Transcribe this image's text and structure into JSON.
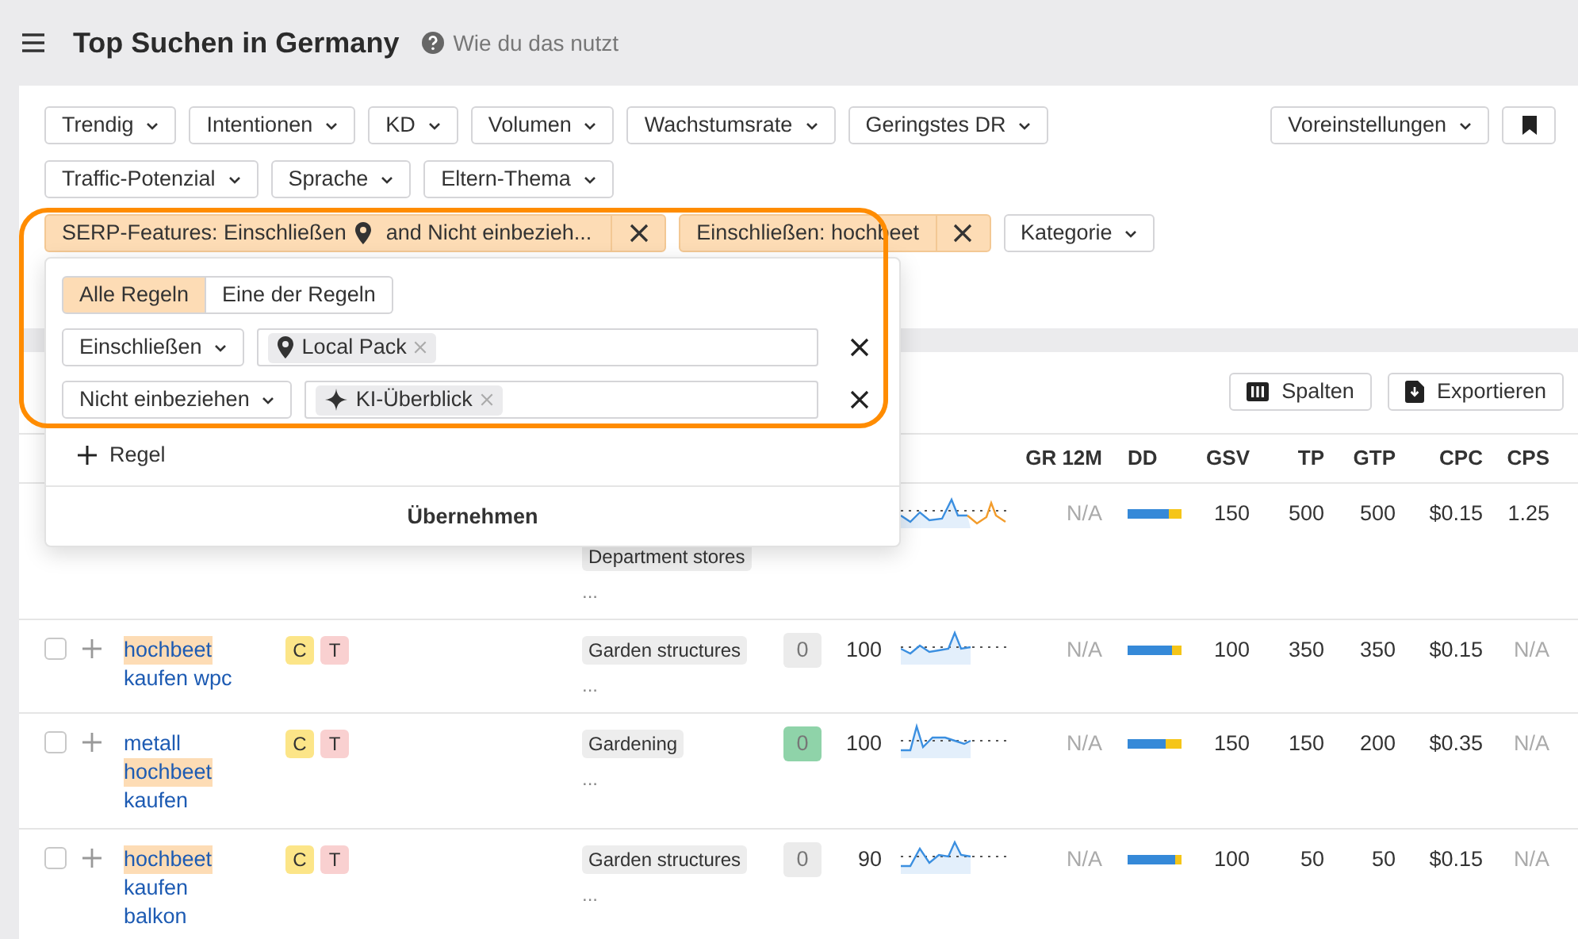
{
  "header": {
    "title": "Top Suchen in Germany",
    "help_link": "Wie du das nutzt"
  },
  "filters": {
    "row_1": [
      "Trendig",
      "Intentionen",
      "KD",
      "Volumen",
      "Wachstumsrate",
      "Geringstes DR"
    ],
    "presets": "Voreinstellungen",
    "row_2": [
      "Traffic-Potenzial",
      "Sprache",
      "Eltern-Thema"
    ],
    "active": [
      {
        "kind": "serp",
        "label": "SERP-Features: Einschließen",
        "label_after": "and Nicht einbezieh..."
      },
      {
        "kind": "plain",
        "label": "Einschließen: hochbeet"
      }
    ],
    "more": "Kategorie"
  },
  "popup": {
    "modes": [
      {
        "label": "Alle Regeln",
        "selected": true
      },
      {
        "label": "Eine der Regeln",
        "selected": false
      }
    ],
    "rules": [
      {
        "operator": "Einschließen",
        "tags": [
          {
            "kind": "pin",
            "label": "Local Pack"
          }
        ]
      },
      {
        "operator": "Nicht einbeziehen",
        "tags": [
          {
            "kind": "sparkle",
            "label": "KI-Überblick"
          }
        ]
      }
    ],
    "add_rule": "Regel",
    "apply": "Übernehmen"
  },
  "toolbar": {
    "columns_button": "Spalten",
    "export_button": "Exportieren"
  },
  "table": {
    "columns": [
      "GR 12M",
      "DD",
      "GSV",
      "TP",
      "GTP",
      "CPC",
      "CPS"
    ],
    "rows": [
      {
        "clipped": true,
        "categories": [
          "Department stores"
        ],
        "more": "...",
        "gr": {
          "text": "N/A",
          "muted": true
        },
        "level": 0.76,
        "gsv": "150",
        "tp": "500",
        "gtp": "500",
        "cpc": "$0.15",
        "cps": {
          "text": "1.25",
          "muted": false
        }
      },
      {
        "checked": false,
        "keyword": [
          {
            "text": "hochbeet",
            "highlighted": true
          },
          {
            "text": "kaufen wpc",
            "highlighted": false
          }
        ],
        "intents": [
          {
            "label": "C",
            "color": "#fce588"
          },
          {
            "label": "T",
            "color": "#f9d0d0"
          }
        ],
        "categories": [
          "Garden structures"
        ],
        "more": "...",
        "kd": {
          "text": "0",
          "color": "#ebebeb"
        },
        "volume": "100",
        "gr": {
          "text": "N/A",
          "muted": true
        },
        "level": 0.83,
        "gsv": "100",
        "tp": "350",
        "gtp": "350",
        "cpc": "$0.15",
        "cps": {
          "text": "N/A",
          "muted": true
        }
      },
      {
        "checked": false,
        "keyword": [
          {
            "text": "metall",
            "highlighted": false
          },
          {
            "text": "hochbeet",
            "highlighted": true
          },
          {
            "text": "kaufen",
            "highlighted": false
          }
        ],
        "intents": [
          {
            "label": "C",
            "color": "#fce588"
          },
          {
            "label": "T",
            "color": "#f9d0d0"
          }
        ],
        "categories": [
          "Gardening"
        ],
        "more": "...",
        "kd": {
          "text": "0",
          "color": "#8fd3a9"
        },
        "volume": "100",
        "gr": {
          "text": "N/A",
          "muted": true
        },
        "level": 0.71,
        "gsv": "150",
        "tp": "150",
        "gtp": "200",
        "cpc": "$0.35",
        "cps": {
          "text": "N/A",
          "muted": true
        }
      },
      {
        "checked": false,
        "keyword": [
          {
            "text": "hochbeet",
            "highlighted": true
          },
          {
            "text": "kaufen",
            "highlighted": false
          },
          {
            "text": "balkon",
            "highlighted": false
          }
        ],
        "intents": [
          {
            "label": "C",
            "color": "#fce588"
          },
          {
            "label": "T",
            "color": "#f9d0d0"
          }
        ],
        "categories": [
          "Garden structures"
        ],
        "more": "...",
        "kd": {
          "text": "0",
          "color": "#ebebeb"
        },
        "volume": "90",
        "gr": {
          "text": "N/A",
          "muted": true
        },
        "level": 0.88,
        "gsv": "100",
        "tp": "50",
        "gtp": "50",
        "cpc": "$0.15",
        "cps": {
          "text": "N/A",
          "muted": true
        }
      }
    ]
  }
}
